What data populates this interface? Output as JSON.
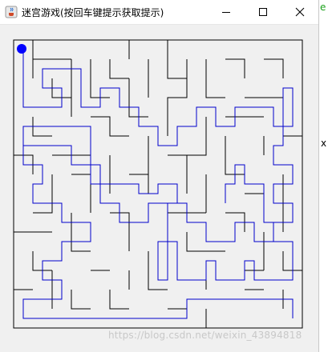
{
  "window": {
    "title": "迷宫游戏(按回车键提示获取提示)",
    "icon": "java-coffee-icon"
  },
  "controls": {
    "minimize_icon": "minimize-icon",
    "maximize_icon": "maximize-icon",
    "close_icon": "close-icon"
  },
  "maze": {
    "wall_color": "#000000",
    "path_color": "#0000cc",
    "player_color": "#0000ff",
    "background": "#f0f0f0"
  },
  "background_window": {
    "glyph_1": "e",
    "glyph_2": "x"
  },
  "watermark": {
    "text": "https://blog.csdn.net/weixin_43894818"
  }
}
